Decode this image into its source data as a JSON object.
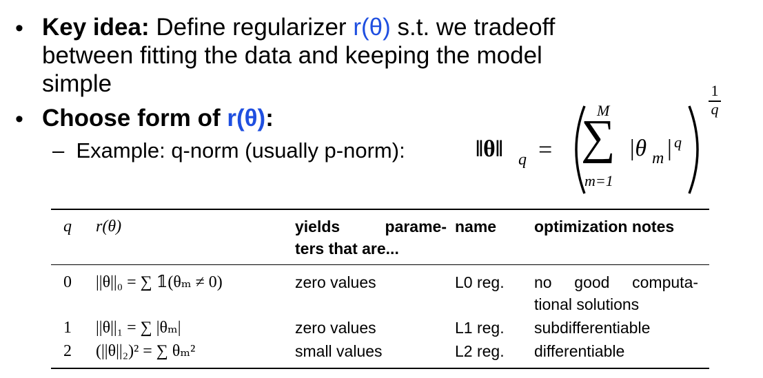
{
  "bullets": [
    {
      "lead": "Key idea:",
      "lines": [
        {
          "before": " Define regularizer ",
          "highlight": "r(θ)",
          "after": " s.t. we tradeoff"
        },
        {
          "text": "between fitting the data and keeping the model"
        },
        {
          "text": "simple"
        }
      ]
    },
    {
      "lead": "Choose form of ",
      "highlight": "r(θ)",
      "after": ":"
    }
  ],
  "sub_bullet": {
    "dash": "–",
    "text": "Example: q-norm (usually p-norm):"
  },
  "formula": {
    "lhs": "‖θ‖",
    "lhs_sub": "q",
    "equals": "=",
    "sum_upper": "M",
    "sum_lower": "m=1",
    "sigma": "∑",
    "term": "|θ",
    "term_sub": "m",
    "term_close": "|",
    "term_exp": "q",
    "outer_exp_num": "1",
    "outer_exp_den": "q"
  },
  "table": {
    "headers": {
      "q": "q",
      "r": "r(θ)",
      "yields_line1_a": "yields",
      "yields_line1_b": "parame-",
      "yields_line2": "ters that are...",
      "name": "name",
      "notes": "optimization notes"
    },
    "rows": [
      {
        "q": "0",
        "r": "||θ||₀ = ∑ 𝟙(θₘ ≠ 0)",
        "yields": "zero values",
        "name": "L0 reg.",
        "notes_line1": [
          "no",
          "good",
          "computa-"
        ],
        "notes_line2": "tional solutions"
      },
      {
        "q": "1",
        "r": "||θ||₁ = ∑ |θₘ|",
        "yields": "zero values",
        "name": "L1 reg.",
        "notes_line1": "subdifferentiable"
      },
      {
        "q": "2",
        "r": "(||θ||₂)² = ∑ θₘ²",
        "yields": "small values",
        "name": "L2 reg.",
        "notes_line1": "differentiable"
      }
    ]
  },
  "colors": {
    "accent": "#1f4fe0",
    "text": "#000000",
    "background": "#ffffff"
  }
}
